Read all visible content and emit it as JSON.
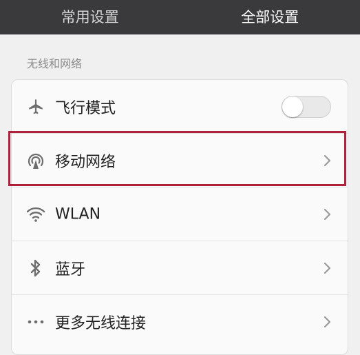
{
  "tabs": [
    {
      "label": "常用设置",
      "active": false
    },
    {
      "label": "全部设置",
      "active": true
    }
  ],
  "section": {
    "title": "无线和网络"
  },
  "rows": [
    {
      "label": "飞行模式",
      "icon": "airplane-icon",
      "control": "toggle",
      "toggle_on": false
    },
    {
      "label": "移动网络",
      "icon": "cellular-signal-icon",
      "control": "chevron",
      "highlighted": true
    },
    {
      "label": "WLAN",
      "icon": "wifi-icon",
      "control": "chevron"
    },
    {
      "label": "蓝牙",
      "icon": "bluetooth-icon",
      "control": "chevron"
    },
    {
      "label": "更多无线连接",
      "icon": "more-dots-icon",
      "control": "chevron"
    }
  ],
  "colors": {
    "tabbar_bg": "#3a3a3c",
    "highlight_border": "#b0203a",
    "icon_gray": "#6e6e6e"
  }
}
